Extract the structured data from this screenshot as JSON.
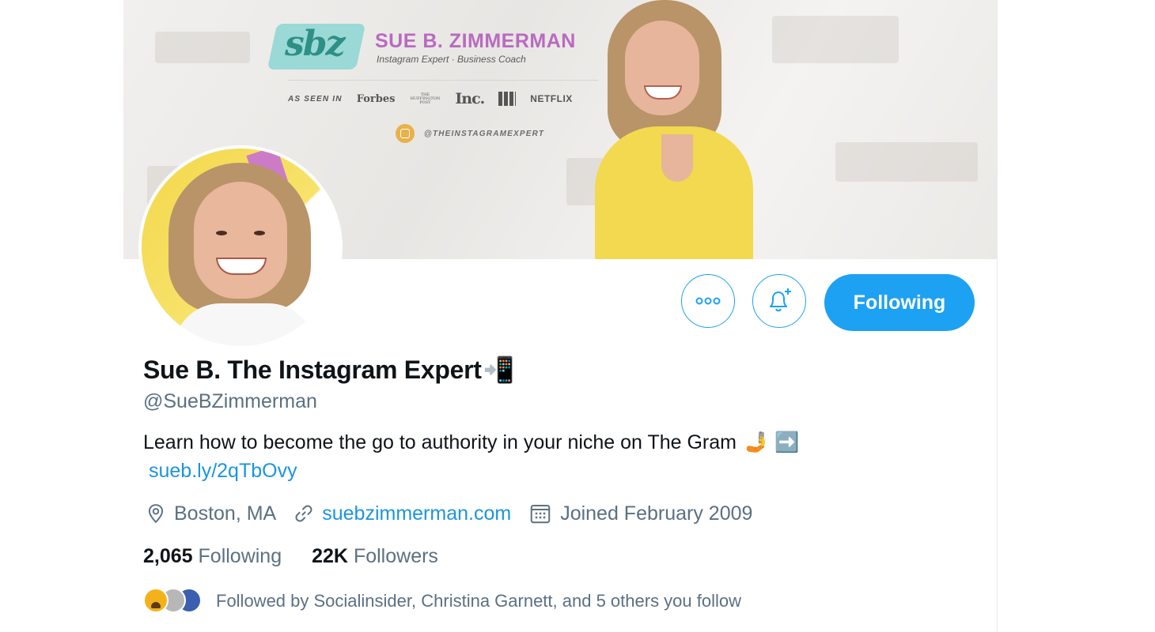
{
  "banner": {
    "logo_text": "sbz",
    "brand_name": "SUE B. ZIMMERMAN",
    "brand_subtitle": "Instagram Expert · Business Coach",
    "as_seen_in_label": "AS SEEN IN",
    "press": [
      "Forbes",
      "THE HUFFINGTON POST",
      "Inc.",
      "NETFLIX"
    ],
    "instagram_handle": "@THEINSTAGRAMEXPERT"
  },
  "actions": {
    "follow_state_label": "Following",
    "more_icon": "more-icon",
    "notify_icon": "bell-plus-icon"
  },
  "profile": {
    "display_name": "Sue B. The Instagram Expert",
    "display_name_emoji": "📲",
    "handle": "@SueBZimmerman",
    "bio_text": "Learn how to become the go to authority in your niche on The Gram",
    "bio_emojis": "🤳 ➡️",
    "bio_link": "sueb.ly/2qTbOvy",
    "location": "Boston, MA",
    "website": "suebzimmerman.com",
    "joined": "Joined February 2009"
  },
  "stats": {
    "following_count": "2,065",
    "following_label": "Following",
    "followers_count": "22K",
    "followers_label": "Followers"
  },
  "followed_by": {
    "text": "Followed by Socialinsider, Christina Garnett, and 5 others you follow"
  },
  "colors": {
    "accent": "#1da1f2",
    "link": "#1b95e0",
    "secondary_text": "#5b7083",
    "brand_pink": "#b86bbf"
  }
}
